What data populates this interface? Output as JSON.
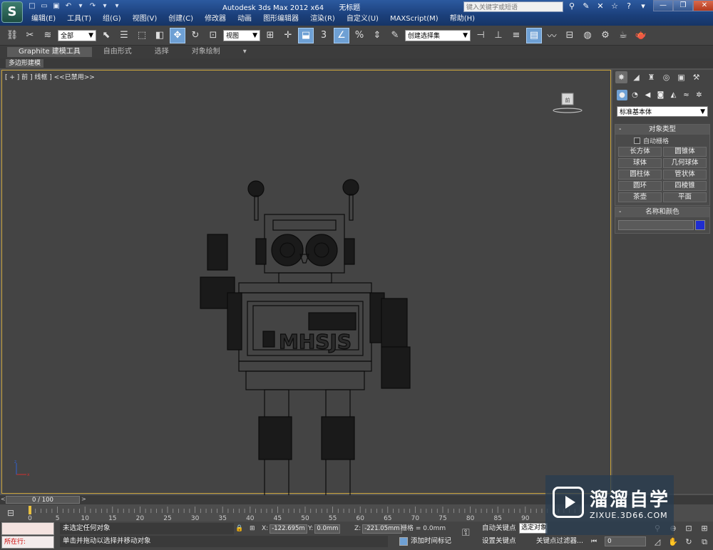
{
  "app": {
    "logo_glyph": "S",
    "title": "Autodesk 3ds Max  2012 x64",
    "doc": "无标题",
    "search_placeholder": "键入关键字或短语"
  },
  "menu": [
    "编辑(E)",
    "工具(T)",
    "组(G)",
    "视图(V)",
    "创建(C)",
    "修改器",
    "动画",
    "图形编辑器",
    "渲染(R)",
    "自定义(U)",
    "MAXScript(M)",
    "帮助(H)"
  ],
  "toolbar": {
    "filter": "全部",
    "ref_coord": "视图",
    "selection_set": "创建选择集",
    "snap_label": "3",
    "angle_label": "%"
  },
  "ribbon": {
    "tabs": [
      "Graphite 建模工具",
      "自由形式",
      "选择",
      "对象绘制"
    ],
    "subtag": "多边形建模"
  },
  "viewport": {
    "label": "[ + ] 前 ] 线框 ] <<已禁用>>",
    "viewcube_label": "前"
  },
  "command_panel": {
    "category": "标准基本体",
    "object_type_title": "对象类型",
    "autogrid": "自动栅格",
    "object_buttons": [
      "长方体",
      "圆锥体",
      "球体",
      "几何球体",
      "圆柱体",
      "管状体",
      "圆环",
      "四棱锥",
      "茶壶",
      "平面"
    ],
    "name_color_title": "名称和颜色",
    "color": "#1f2dd0"
  },
  "timeline": {
    "slider": "0 / 100",
    "ticks": [
      "0",
      "5",
      "10",
      "15",
      "20",
      "25",
      "30",
      "35",
      "40",
      "45",
      "50",
      "55",
      "60",
      "65",
      "70",
      "75",
      "80",
      "85",
      "90"
    ]
  },
  "status": {
    "selection": "未选定任何对象",
    "hint": "单击并拖动以选择并移动对象",
    "running": "所在行:",
    "x_label": "X:",
    "x": "-122.695m",
    "y_label": "Y:",
    "y": "0.0mm",
    "z_label": "Z:",
    "z": "-221.05mm",
    "grid": "栅格 = 0.0mm",
    "add_time_tag": "添加时间标记",
    "auto_key": "自动关键点",
    "selected": "选定对象",
    "set_key": "设置关键点",
    "key_filters": "关键点过滤器...",
    "frame": "0"
  },
  "watermark": {
    "cn": "溜溜自学",
    "en": "ZIXUE.3D66.COM"
  }
}
